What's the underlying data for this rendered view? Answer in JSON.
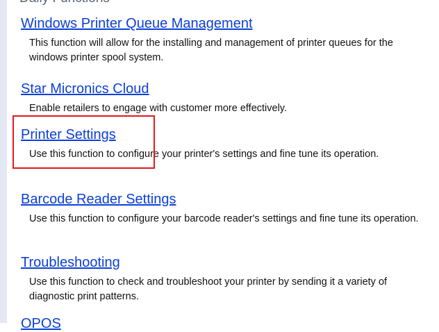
{
  "header": {
    "partial_heading": "Daily Functions"
  },
  "items": [
    {
      "label": "Windows Printer Queue Management",
      "description": "This function will allow for the installing and management of printer queues for the windows printer spool system."
    },
    {
      "label": "Star Micronics Cloud",
      "description": "Enable retailers to engage with customer more effectively."
    },
    {
      "label": "Printer Settings",
      "description": "Use this function to configure your printer's settings and fine tune its operation."
    },
    {
      "label": "Barcode Reader Settings",
      "description": "Use this function to configure your barcode reader's settings and fine tune its operation."
    },
    {
      "label": "Troubleshooting",
      "description": "Use this function to check and troubleshoot your printer by sending it a variety of diagnostic print patterns."
    }
  ],
  "footer": {
    "partial_link": "OPOS"
  },
  "colors": {
    "link": "#0b3fd6",
    "highlight": "#e3171b",
    "rail": "#e3e8f3"
  }
}
